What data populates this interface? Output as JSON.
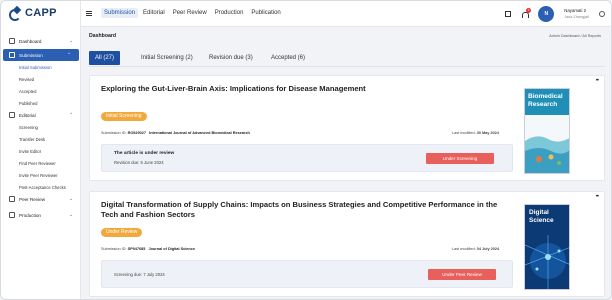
{
  "app": {
    "logo_text": "CAPP"
  },
  "sidebar": {
    "items": [
      {
        "label": "Dashboard",
        "type": "parent"
      },
      {
        "label": "Submission",
        "type": "active"
      },
      {
        "label": "Initial Submission",
        "type": "sub-current"
      },
      {
        "label": "Revised",
        "type": "sub"
      },
      {
        "label": "Accepted",
        "type": "sub"
      },
      {
        "label": "Published",
        "type": "sub"
      },
      {
        "label": "Editorial",
        "type": "parent"
      },
      {
        "label": "Screening",
        "type": "sub"
      },
      {
        "label": "Transfer Desk",
        "type": "sub"
      },
      {
        "label": "Invite Editor",
        "type": "sub"
      },
      {
        "label": "Find Peer Reviewer",
        "type": "sub"
      },
      {
        "label": "Invite Peer Reviewer",
        "type": "sub"
      },
      {
        "label": "Post-Acceptance Checks",
        "type": "sub"
      },
      {
        "label": "Peer Review",
        "type": "parent"
      },
      {
        "label": "Production",
        "type": "parent"
      }
    ]
  },
  "topbar": {
    "tabs": [
      "Submission",
      "Editorial",
      "Peer Review",
      "Production",
      "Publication"
    ],
    "active_tab": "Submission",
    "notification_count": "1",
    "user_name": "Nayamati 2",
    "user_role": "Jasa Zhangjati",
    "avatar_initials": "N"
  },
  "main": {
    "title": "Dashboard",
    "breadcrumb": "Admin Dashboard / All Reports",
    "filter_tabs": [
      "All (27)",
      "Initial Screening (2)",
      "Revision due (3)",
      "Accepted (6)"
    ],
    "active_filter": "All (27)"
  },
  "cards": [
    {
      "title": "Exploring the Gut-Liver-Brain Axis: Implications for Disease Management",
      "status": "Initial Screening",
      "submission_label": "Submission ID:",
      "submission_id": "RO929027",
      "journal": "International Journal of Advanced Biomedical Research",
      "modified_label": "Last modified:",
      "modified_date": "30 May 2024",
      "status_line": "The article is under review",
      "status_detail": "Revision due: 5 June 2024",
      "action": "Under Screening",
      "cover_title": "Biomedical Research"
    },
    {
      "title": "Digital Transformation of Supply Chains: Impacts on Business Strategies and Competitive Performance in the Tech and Fashion Sectors",
      "status": "Under Review",
      "submission_label": "Submission ID:",
      "submission_id": "SP947685",
      "journal": "Journal of Digital Science",
      "modified_label": "Last modified:",
      "modified_date": "04 July 2024",
      "status_line": "",
      "status_detail": "Screening due: 7 July 2024",
      "action": "Under Peer Review",
      "cover_title": "Digital Science"
    }
  ],
  "colors": {
    "primary": "#1e4fa0",
    "pill": "#f2a93b",
    "action": "#e8605c"
  }
}
